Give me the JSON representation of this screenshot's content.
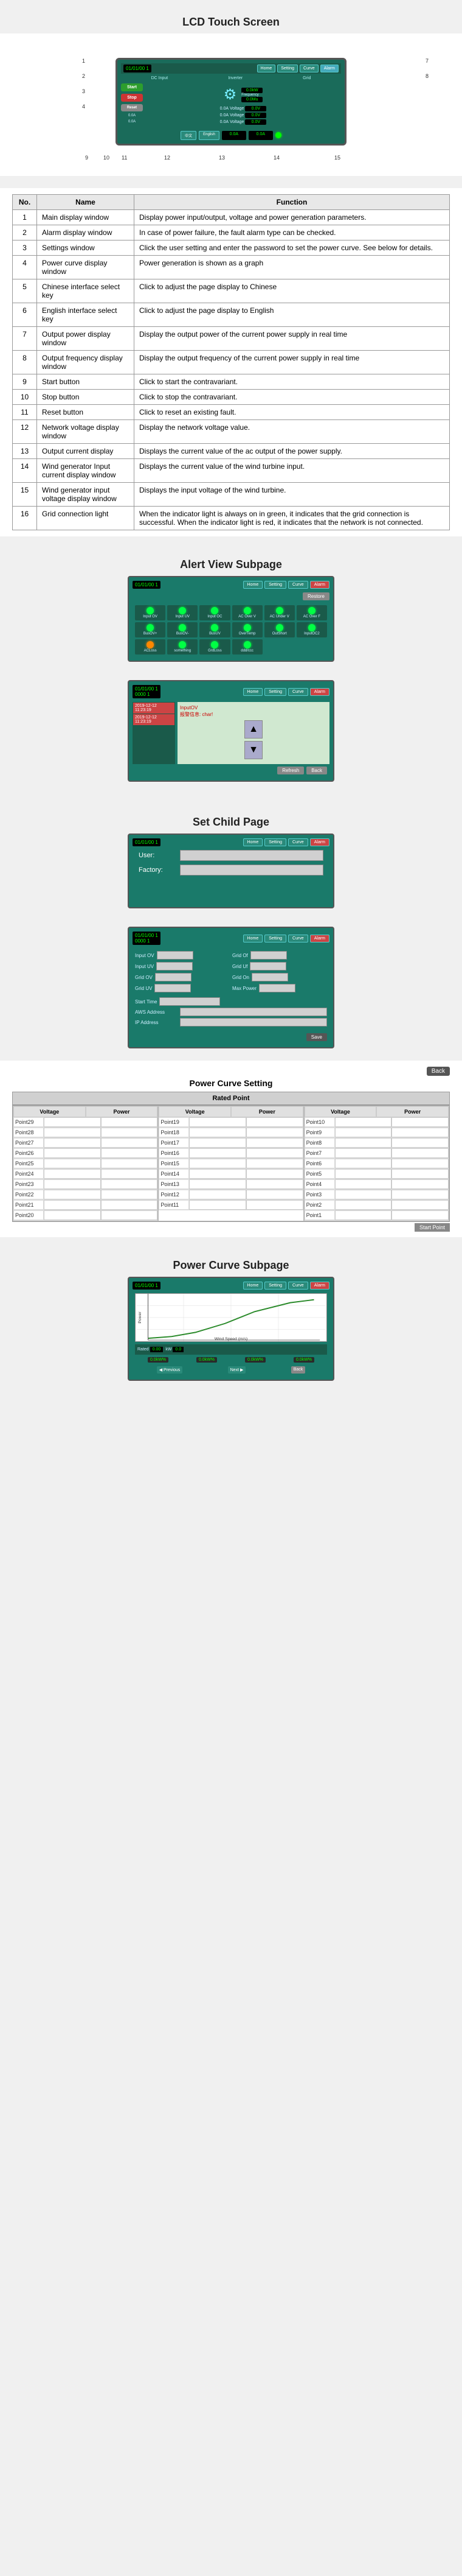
{
  "sections": {
    "lcd_title": "LCD Touch Screen",
    "alert_title": "Alert View Subpage",
    "set_child_title": "Set Child Page",
    "power_curve_setting_title": "Power Curve Setting",
    "power_curve_subpage_title": "Power Curve Subpage"
  },
  "lcd": {
    "time": "01/01/00 1",
    "nav": [
      "Home",
      "Setting",
      "Curve",
      "Alarm"
    ],
    "dc_label": "DC Input",
    "inverter_label": "Inverter",
    "grid_label": "Grid",
    "btn_start": "Start",
    "btn_stop": "Stop",
    "btn_reset": "Reset",
    "power_value": "0.0kW",
    "power_value2": "0.0Mu",
    "frequency_label": "Frequency",
    "values": {
      "voltage1": "0.0V",
      "voltage2": "0.0V",
      "voltage3": "0.0V",
      "current1": "0.0A",
      "current2": "0.0A",
      "current3": "0.0A",
      "current4": "0.0A"
    },
    "annotations": [
      {
        "id": 1,
        "text": "Main display window"
      },
      {
        "id": 2,
        "text": "Alarm display window"
      },
      {
        "id": 3,
        "text": "Settings window"
      },
      {
        "id": 4,
        "text": "Power curve display window"
      },
      {
        "id": 5,
        "text": "Chinese interface select key"
      },
      {
        "id": 6,
        "text": "English interface select"
      },
      {
        "id": 7,
        "text": "Grid connection light"
      },
      {
        "id": 8,
        "text": "Network voltage display window"
      },
      {
        "id": 9,
        "text": "Start button"
      },
      {
        "id": 10,
        "text": "Stop button"
      },
      {
        "id": 11,
        "text": "Reset button"
      },
      {
        "id": 12,
        "text": "Output power display window"
      },
      {
        "id": 13,
        "text": "Output current display"
      },
      {
        "id": 14,
        "text": "Wind generator input current display"
      },
      {
        "id": 15,
        "text": "Wind generator input voltage display"
      }
    ]
  },
  "table": {
    "headers": [
      "No.",
      "Name",
      "Function"
    ],
    "rows": [
      {
        "no": 1,
        "name": "Main display window",
        "function": "Display power input/output, voltage and power generation parameters."
      },
      {
        "no": 2,
        "name": "Alarm display window",
        "function": "In case of power failure, the fault alarm type can be checked."
      },
      {
        "no": 3,
        "name": "Settings window",
        "function": "Click the user setting and enter the password to set the power curve. See below for details."
      },
      {
        "no": 4,
        "name": "Power curve display window",
        "function": "Power generation is shown as a graph"
      },
      {
        "no": 5,
        "name": "Chinese interface select key",
        "function": "Click to adjust the page display to Chinese"
      },
      {
        "no": 6,
        "name": "English interface select key",
        "function": "Click to adjust the page display to English"
      },
      {
        "no": 7,
        "name": "Output power display window",
        "function": "Display the output power of the current power supply in real time"
      },
      {
        "no": 8,
        "name": "Output frequency display window",
        "function": "Display the output frequency of the current power supply in real time"
      },
      {
        "no": 9,
        "name": "Start button",
        "function": "Click to start the contravariant."
      },
      {
        "no": 10,
        "name": "Stop button",
        "function": "Click to stop the contravariant."
      },
      {
        "no": 11,
        "name": "Reset button",
        "function": "Click to reset an existing fault."
      },
      {
        "no": 12,
        "name": "Network voltage display window",
        "function": "Display the network voltage value."
      },
      {
        "no": 13,
        "name": "Output current display",
        "function": "Displays the current value of the ac output of the power supply."
      },
      {
        "no": 14,
        "name": "Wind generator Input current display window",
        "function": "Displays the current value of the wind turbine input."
      },
      {
        "no": 15,
        "name": "Wind generator input voltage display window",
        "function": "Displays the input voltage of the wind turbine."
      },
      {
        "no": 16,
        "name": "Grid connection light",
        "function": "When the indicator light is always on in green, it indicates that the grid connection is successful. When the indicator light is red, it indicates that the network is not connected."
      }
    ]
  },
  "alert_view": {
    "time": "01/01/00 1",
    "nav": [
      "Home",
      "Setting",
      "Curve",
      "Alarm"
    ],
    "alarm_btn": "Alarm",
    "restore_btn": "Restore",
    "alerts": [
      {
        "label": "Input OV",
        "active": true
      },
      {
        "label": "Input UV",
        "active": true
      },
      {
        "label": "Input OC",
        "active": true
      },
      {
        "label": "AC Over V",
        "active": true
      },
      {
        "label": "AC Under V",
        "active": true
      },
      {
        "label": "AC Over F",
        "active": true
      },
      {
        "label": "BusOV+",
        "active": true
      },
      {
        "label": "BusOV-",
        "active": true
      },
      {
        "label": "BusUV",
        "active": true
      },
      {
        "label": "OverTemp",
        "active": true
      },
      {
        "label": "OutShort",
        "active": true
      },
      {
        "label": "InputOC2",
        "active": true
      },
      {
        "label": "ACLoss",
        "active": true
      },
      {
        "label": "something",
        "active": false
      },
      {
        "label": "GrdLoss",
        "active": true
      },
      {
        "label": "ddd/ccc",
        "active": true
      }
    ],
    "log": [
      {
        "time": "2019-12-12 11:23:19",
        "msg": "InputOV",
        "color": "red"
      },
      {
        "time": "2019-12-12 11:23:19",
        "msg": "报警信息",
        "color": "red"
      }
    ],
    "refresh_btn": "Refresh",
    "back_btn": "Back"
  },
  "set_child": {
    "time": "01/01/00 1",
    "nav": [
      "Home",
      "Setting",
      "Curve",
      "Alarm"
    ],
    "user_label": "User:",
    "user_placeholder": "",
    "factory_label": "Factory:",
    "factory_placeholder": ""
  },
  "settings_sub": {
    "time": "01/01/00 1",
    "nav": [
      "Home",
      "Setting",
      "Curve",
      "Alarm"
    ],
    "fields": [
      {
        "label": "Input OV",
        "value": ""
      },
      {
        "label": "Input UV",
        "value": ""
      },
      {
        "label": "Grid OV",
        "value": ""
      },
      {
        "label": "Grid UV",
        "value": ""
      },
      {
        "label": "Grid Of",
        "value": ""
      },
      {
        "label": "Grid Uf",
        "value": ""
      },
      {
        "label": "Grid On",
        "value": ""
      },
      {
        "label": "Max Power",
        "value": ""
      },
      {
        "label": "Start Time",
        "value": ""
      }
    ],
    "save_btn": "Save",
    "aws_label": "AWS Address",
    "ip_label": "IP Address"
  },
  "power_curve_setting": {
    "back_btn": "Back",
    "rated_point": "Rated Point",
    "col_headers": [
      "",
      "Voltage",
      "Power"
    ],
    "points": [
      "Point29",
      "Point28",
      "Point27",
      "Point26",
      "Point25",
      "Point24",
      "Point23",
      "Point21",
      "Point20",
      "Point19",
      "Point18",
      "Point17",
      "Point16",
      "Point15",
      "Point14",
      "Point13",
      "Point12",
      "Point11",
      "Point10",
      "Point9",
      "Point8",
      "Point7",
      "Point6",
      "Point5",
      "Point4",
      "Point3",
      "Point2",
      "Point1"
    ],
    "start_point_btn": "Start Point"
  },
  "power_curve_sub": {
    "time": "01/01/00 1",
    "nav": [
      "Home",
      "Setting",
      "Curve",
      "Alarm"
    ],
    "chart": {
      "x_label": "Wind Speed (m/s)",
      "y_label": "Power (kW)"
    },
    "bottom_values": [
      "0.0kW%",
      "0.0kW%",
      "0.0kW%",
      "0.0kW%"
    ]
  }
}
